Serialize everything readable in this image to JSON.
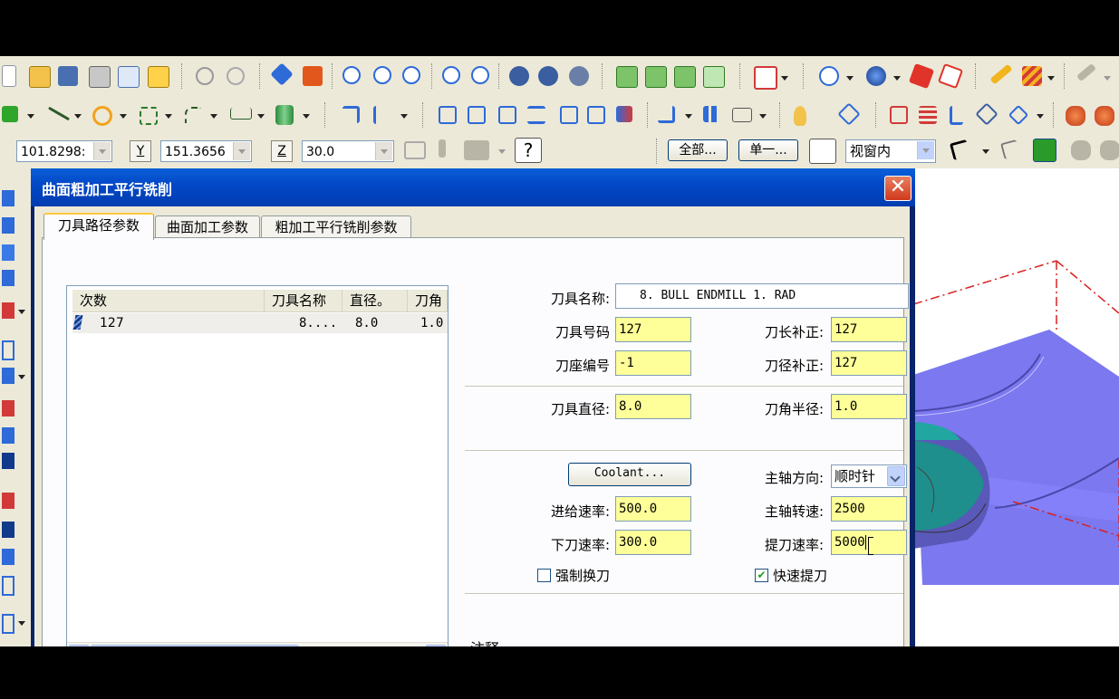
{
  "toolbar1": {
    "icons": [
      "new-file-icon",
      "open-folder-icon",
      "save-icon",
      "print-icon",
      "print-preview-icon",
      "help-icon",
      "undo-icon",
      "redo-icon",
      "pan-icon",
      "repaint-icon",
      "zoom-window-icon",
      "zoom-in-icon",
      "zoom-out-icon",
      "zoom-previous-icon",
      "zoom-target-icon",
      "rotate-icon",
      "dynamic-rotate-icon",
      "light-icon",
      "cube-top-icon",
      "cube-front-icon",
      "cube-side-icon",
      "cube-iso-icon",
      "view-cube-icon",
      "globe-icon",
      "shade-icon",
      "solid-red-icon",
      "wire-icon",
      "pencil-icon",
      "hatch-icon",
      "analyze-icon"
    ]
  },
  "toolbar2": {
    "icons": [
      "point-icon",
      "line-icon",
      "arc-icon",
      "rect-icon",
      "fillet-icon",
      "dimension-icon",
      "cylinder-icon",
      "trim-icon",
      "divide-icon",
      "transform-icon",
      "mirror-icon",
      "rotate-entity-icon",
      "scale-icon",
      "offset-icon",
      "array-icon",
      "project-icon",
      "layer-icon",
      "level-icon",
      "spreadsheet-icon",
      "book-icon",
      "bookmark-icon",
      "eraser-icon",
      "gears-icon",
      "gears2-icon"
    ]
  },
  "coords": {
    "x_value": "101.8298:",
    "y_label": "Y",
    "y_value": "151.3656",
    "z_label": "Z",
    "z_value": "30.0",
    "all_button": "全部...",
    "single_button": "单一...",
    "select_mode": "视窗内"
  },
  "dialog": {
    "title": "曲面粗加工平行铣削",
    "close_symbol": "✕",
    "tabs": [
      {
        "label": "刀具路径参数"
      },
      {
        "label": "曲面加工参数"
      },
      {
        "label": "粗加工平行铣削参数"
      }
    ],
    "list": {
      "columns": [
        "次数",
        "刀具名称",
        "直径。",
        "刀角"
      ],
      "rows": [
        {
          "number": "127",
          "name": "8....",
          "diameter": "8.0",
          "corner": "1.0"
        }
      ]
    },
    "fields": {
      "tool_name_label": "刀具名称:",
      "tool_name_value": "8. BULL ENDMILL 1. RAD",
      "tool_number_label": "刀具号码",
      "tool_number_value": "127",
      "length_offset_label": "刀长补正:",
      "length_offset_value": "127",
      "holder_number_label": "刀座编号",
      "holder_number_value": "-1",
      "dia_offset_label": "刀径补正:",
      "dia_offset_value": "127",
      "tool_dia_label": "刀具直径:",
      "tool_dia_value": "8.0",
      "corner_radius_label": "刀角半径:",
      "corner_radius_value": "1.0",
      "coolant_button": "Coolant...",
      "spindle_dir_label": "主轴方向:",
      "spindle_dir_value": "顺时针",
      "feed_rate_label": "进给速率:",
      "feed_rate_value": "500.0",
      "spindle_speed_label": "主轴转速:",
      "spindle_speed_value": "2500",
      "plunge_rate_label": "下刀速率:",
      "plunge_rate_value": "300.0",
      "retract_rate_label": "提刀速率:",
      "retract_rate_value": "5000",
      "force_tool_change_label": "强制换刀",
      "force_tool_change_checked": false,
      "rapid_retract_label": "快速提刀",
      "rapid_retract_checked": true,
      "comment_label": "注释"
    }
  }
}
